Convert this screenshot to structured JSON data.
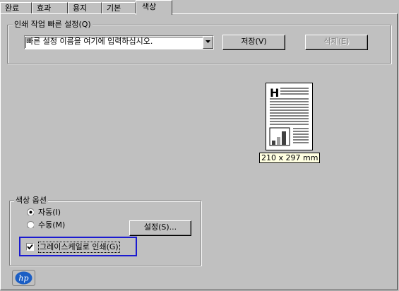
{
  "tabs": [
    {
      "label": "완료"
    },
    {
      "label": "효과"
    },
    {
      "label": "용지"
    },
    {
      "label": "기본"
    },
    {
      "label": "색상"
    }
  ],
  "quick_sets": {
    "group_title": "인쇄 작업 빠른 설정(Q)",
    "input_value": "빠른 설정 이름을 여기에 입력하십시오.",
    "save_label": "저장(V)",
    "delete_label": "삭제(E)"
  },
  "preview": {
    "paper_size": "210 x 297 mm",
    "heading_letter": "H"
  },
  "color_options": {
    "group_title": "색상 옵션",
    "auto_label": "자동(I)",
    "manual_label": "수동(M)",
    "settings_label": "설정(S)...",
    "grayscale_label": "그레이스케일로 인쇄(G)",
    "selected": "auto",
    "grayscale_checked": true
  },
  "brand": {
    "logo_text": "hp",
    "logo_color": "#1b5ec4"
  }
}
